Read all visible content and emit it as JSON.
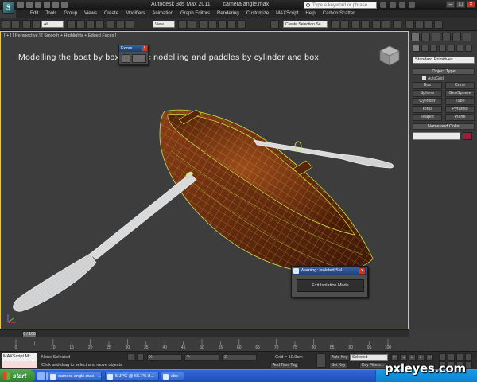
{
  "window": {
    "app_title": "Autodesk 3ds Max  2011",
    "file_name": "camera angle.max",
    "search_placeholder": "Type a keyword or phrase",
    "logo_letter": "S"
  },
  "menu": [
    "Edit",
    "Tools",
    "Group",
    "Views",
    "Create",
    "Modifiers",
    "Animation",
    "Graph Editors",
    "Rendering",
    "Customize",
    "MAXScript",
    "Help",
    "Carbon Scatter"
  ],
  "toolbar": {
    "selection_filter": "All",
    "reference_coord": "View",
    "named_selection": "Create Selection Se"
  },
  "viewport": {
    "label": "[ + ] [ Perspective ] [ Smooth + Highlights + Edged Faces ]",
    "caption": "Modelling the boat by box organic nodelling and paddles by cylinder and box"
  },
  "extras_toolbar": {
    "title": "Extras"
  },
  "warning_dialog": {
    "title": "Warning: Isolated Sel...",
    "button": "Exit Isolation Mode"
  },
  "command_panel": {
    "dropdown": "Standard Primitives",
    "object_type_header": "Object Type",
    "autogrid": "AutoGrid",
    "object_buttons": [
      "Box",
      "Cone",
      "Sphere",
      "GeoSphere",
      "Cylinder",
      "Tube",
      "Torus",
      "Pyramid",
      "Teapot",
      "Plane"
    ],
    "name_color_header": "Name and Color"
  },
  "timeline": {
    "frame_readout": "0 / 100",
    "tick_labels": [
      "0",
      "10",
      "15",
      "20",
      "25",
      "30",
      "35",
      "40",
      "45",
      "50",
      "55",
      "60",
      "65",
      "70",
      "75",
      "80",
      "85",
      "90",
      "95",
      "100"
    ]
  },
  "status_bar": {
    "maxscript_label": "MAXScript Mi:",
    "selection_status": "None Selected",
    "prompt": "Click and drag to select and move objects",
    "x_label": "X:",
    "y_label": "Y:",
    "z_label": "Z:",
    "grid": "Grid = 10.0cm",
    "add_time_tag": "Add Time Tag",
    "auto_key": "Auto Key",
    "set_key": "Set Key",
    "key_mode": "Selected",
    "key_filters": "Key Filters..."
  },
  "taskbar": {
    "start_label": "start",
    "tasks": [
      "camera angle.max - ...",
      "5.JPG @ 66.7% (I...",
      "abc"
    ]
  },
  "watermark": "pxleyes.com",
  "colors": {
    "viewport_border": "#e7c74a",
    "boat_wood": "#6b2d10",
    "wireframe": "#c9e64a",
    "warning_title": "#2a55a0",
    "taskbar": "#245edb"
  }
}
